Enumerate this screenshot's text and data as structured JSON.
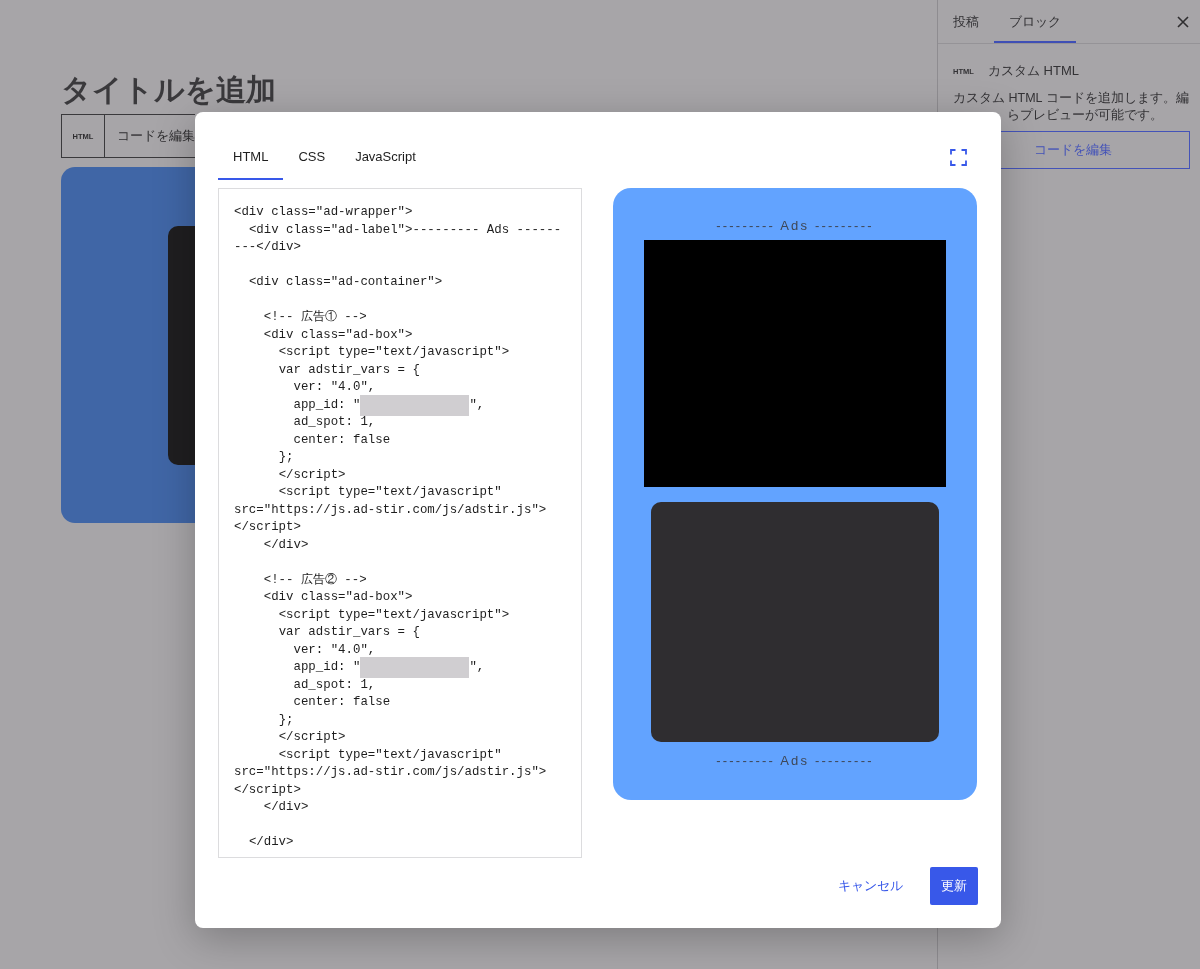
{
  "editor": {
    "title": "タイトルを追加",
    "toolbar": {
      "block_type": "HTML",
      "edit_button": "コードを編集"
    }
  },
  "sidebar": {
    "tabs": [
      {
        "label": "投稿",
        "selected": false
      },
      {
        "label": "ブロック",
        "selected": true
      }
    ],
    "block": {
      "type_icon": "HTML",
      "name": "カスタム HTML",
      "description": "カスタム HTML コードを追加します。編",
      "description_continued": "らプレビューが可能です。",
      "edit_button": "コードを編集"
    }
  },
  "modal": {
    "tabs": [
      {
        "label": "HTML",
        "selected": true
      },
      {
        "label": "CSS",
        "selected": false
      },
      {
        "label": "JavaScript",
        "selected": false
      }
    ],
    "code_blocks": [
      {
        "lines": [
          {
            "kind": "code",
            "text": "<div class=\"ad-wrapper\">"
          },
          {
            "kind": "code",
            "text": "  <div class=\"ad-label\">--------- Ads ------"
          },
          {
            "kind": "code",
            "text": "---</div>"
          }
        ]
      },
      {
        "lines": [
          {
            "kind": "code",
            "text": "  <div class=\"ad-container\">"
          }
        ]
      },
      {
        "lines": [
          {
            "kind": "code",
            "text": "    <!-- 広告① -->"
          },
          {
            "kind": "code",
            "text": "    <div class=\"ad-box\">"
          },
          {
            "kind": "code",
            "text": "      <script type=\"text/javascript\">"
          },
          {
            "kind": "code",
            "text": "      var adstir_vars = {"
          },
          {
            "kind": "code",
            "text": "        ver: \"4.0\","
          },
          {
            "kind": "redacted",
            "text": "        app_id: \"",
            "suffix": "\","
          },
          {
            "kind": "code",
            "text": "        ad_spot: 1,"
          },
          {
            "kind": "code",
            "text": "        center: false"
          },
          {
            "kind": "code",
            "text": "      };"
          },
          {
            "kind": "code",
            "text": "      </script>"
          },
          {
            "kind": "code",
            "text": "      <script type=\"text/javascript\""
          },
          {
            "kind": "code",
            "text": "src=\"https://js.ad-stir.com/js/adstir.js\">"
          },
          {
            "kind": "code",
            "text": "</script>"
          },
          {
            "kind": "code",
            "text": "    </div>"
          }
        ]
      },
      {
        "lines": [
          {
            "kind": "code",
            "text": "    <!-- 広告② -->"
          },
          {
            "kind": "code",
            "text": "    <div class=\"ad-box\">"
          },
          {
            "kind": "code",
            "text": "      <script type=\"text/javascript\">"
          },
          {
            "kind": "code",
            "text": "      var adstir_vars = {"
          },
          {
            "kind": "code",
            "text": "        ver: \"4.0\","
          },
          {
            "kind": "redacted",
            "text": "        app_id: \"",
            "suffix": "\","
          },
          {
            "kind": "code",
            "text": "        ad_spot: 1,"
          },
          {
            "kind": "code",
            "text": "        center: false"
          },
          {
            "kind": "code",
            "text": "      };"
          },
          {
            "kind": "code",
            "text": "      </script>"
          },
          {
            "kind": "code",
            "text": "      <script type=\"text/javascript\""
          },
          {
            "kind": "code",
            "text": "src=\"https://js.ad-stir.com/js/adstir.js\">"
          },
          {
            "kind": "code",
            "text": "</script>"
          },
          {
            "kind": "code",
            "text": "    </div>"
          }
        ]
      },
      {
        "lines": [
          {
            "kind": "code",
            "text": "  </div>"
          }
        ]
      }
    ],
    "preview": {
      "top_label": "--------- Ads ---------",
      "bottom_label": "--------- Ads ---------"
    },
    "buttons": {
      "cancel": "キャンセル",
      "update": "更新"
    }
  }
}
